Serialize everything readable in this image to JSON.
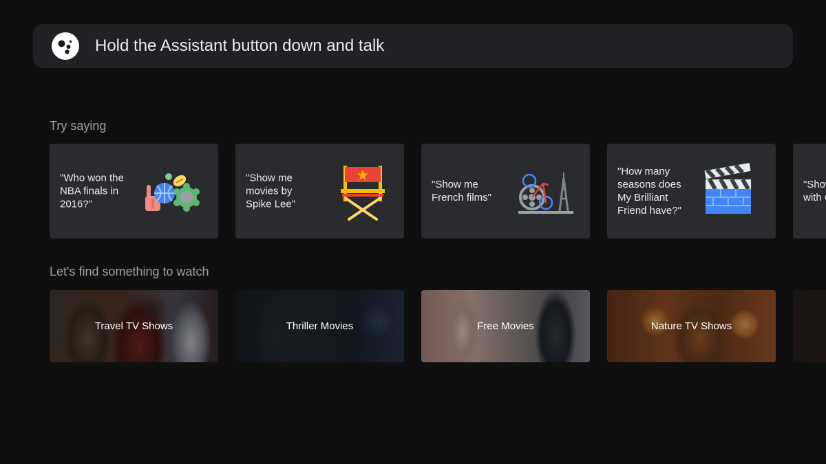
{
  "assistant": {
    "prompt": "Hold the Assistant button down and talk",
    "icon": "google-assistant-icon"
  },
  "sections": {
    "try_saying": "Try saying",
    "find_watch": "Let's find something to watch"
  },
  "suggestions": [
    {
      "text": "\"Who won the NBA finals in 2016?\"",
      "icon": "sports-collage-icon"
    },
    {
      "text": "\"Show me movies by Spike Lee\"",
      "icon": "director-chair-icon"
    },
    {
      "text": "\"Show me French films\"",
      "icon": "film-reel-eiffel-icon"
    },
    {
      "text": "\"How many seasons does My Brilliant Friend have?\"",
      "icon": "clapperboard-icon"
    },
    {
      "text": "\"Show action with Cruis",
      "icon": ""
    }
  ],
  "categories": [
    {
      "label": "Travel TV Shows"
    },
    {
      "label": "Thriller Movies"
    },
    {
      "label": "Free Movies"
    },
    {
      "label": "Nature TV Shows"
    },
    {
      "label": ""
    }
  ],
  "colors": {
    "background": "#0f0f0f",
    "bar": "#202124",
    "card": "#2a2b2e",
    "text_primary": "#e8eaed",
    "text_secondary": "#9aa0a6"
  }
}
